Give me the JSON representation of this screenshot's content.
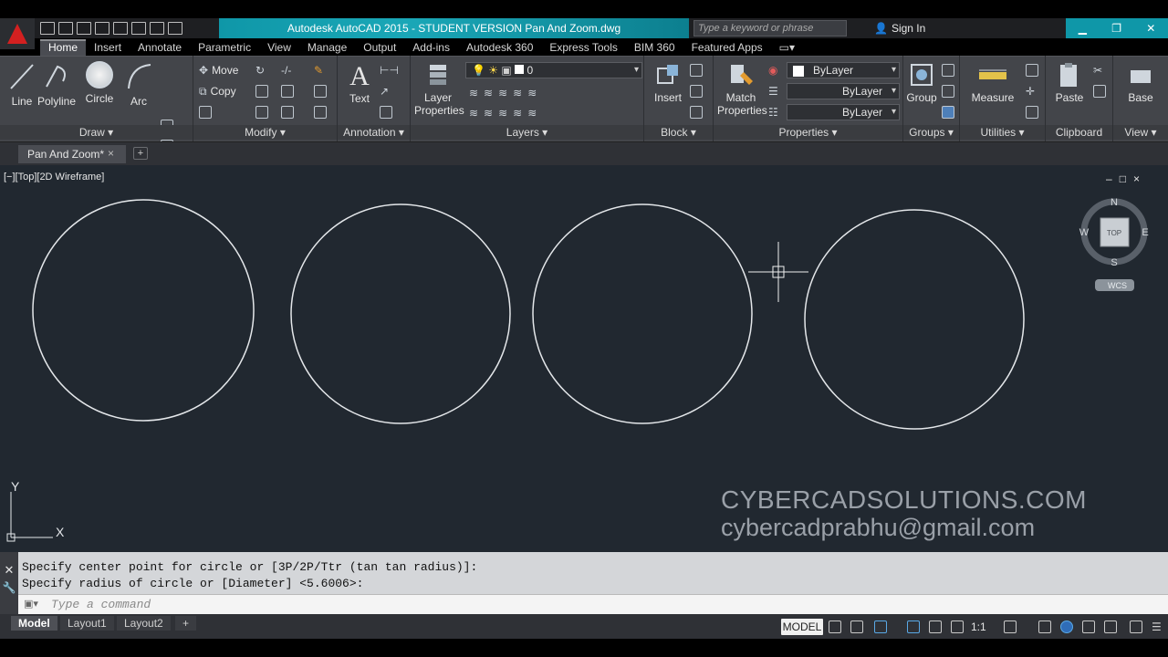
{
  "window": {
    "title": "Autodesk AutoCAD 2015 - STUDENT VERSION    Pan And Zoom.dwg",
    "search_placeholder": "Type a keyword or phrase",
    "sign_in": "Sign In"
  },
  "ribbon_tabs": [
    "Home",
    "Insert",
    "Annotate",
    "Parametric",
    "View",
    "Manage",
    "Output",
    "Add-ins",
    "Autodesk 360",
    "Express Tools",
    "BIM 360",
    "Featured Apps"
  ],
  "ribbon": {
    "draw": {
      "label": "Draw",
      "tools": [
        "Line",
        "Polyline",
        "Circle",
        "Arc"
      ]
    },
    "modify": {
      "label": "Modify",
      "move": "Move",
      "copy": "Copy"
    },
    "annotation": {
      "label": "Annotation",
      "text": "Text"
    },
    "layers": {
      "label": "Layers",
      "layer_properties_1": "Layer",
      "layer_properties_2": "Properties",
      "current_layer": "0"
    },
    "block": {
      "label": "Block",
      "insert": "Insert"
    },
    "properties": {
      "label": "Properties",
      "match_1": "Match",
      "match_2": "Properties",
      "color": "ByLayer",
      "linetype": "ByLayer",
      "lineweight": "ByLayer"
    },
    "groups": {
      "label": "Groups",
      "group": "Group"
    },
    "utilities": {
      "label": "Utilities",
      "measure": "Measure"
    },
    "clipboard": {
      "label": "Clipboard",
      "paste": "Paste"
    },
    "view": {
      "label": "View",
      "base": "Base"
    }
  },
  "document_tab": {
    "name": "Pan And Zoom*",
    "close": "×",
    "new": "+"
  },
  "viewport": {
    "label": "[−][Top][2D Wireframe]",
    "controls": [
      "–",
      "□",
      "×"
    ],
    "viewcube": {
      "top": "TOP",
      "n": "N",
      "s": "S",
      "e": "E",
      "w": "W",
      "wcs": "WCS"
    },
    "ucs": {
      "x": "X",
      "y": "Y"
    }
  },
  "watermark": {
    "line1": "CYBERCADSOLUTIONS.COM",
    "line2": "cybercadprabhu@gmail.com"
  },
  "command": {
    "history": [
      "Specify center point for circle or [3P/2P/Ttr (tan tan radius)]:",
      "Specify radius of circle or [Diameter] <5.6006>:"
    ],
    "placeholder": "Type a command"
  },
  "layout_tabs": [
    "Model",
    "Layout1",
    "Layout2",
    "+"
  ],
  "status": {
    "model": "MODEL",
    "scale": "1:1"
  },
  "colors": {
    "canvas": "#212830",
    "accent": "#0f97a8",
    "ribbon": "#43454a"
  }
}
